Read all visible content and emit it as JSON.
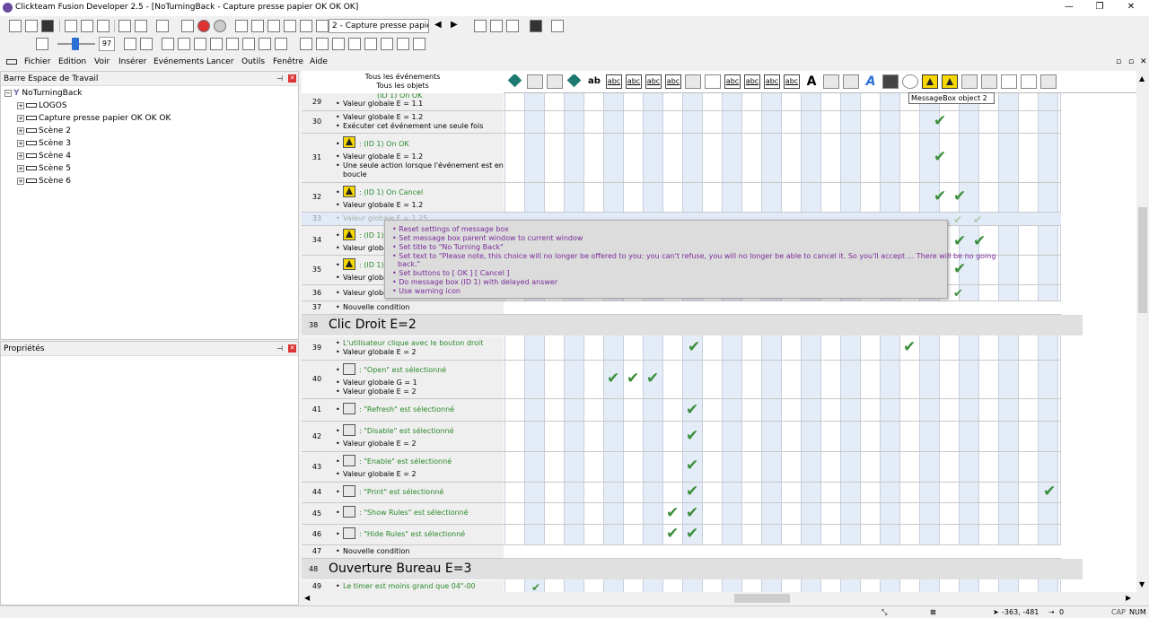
{
  "window": {
    "title": "Clickteam Fusion Developer 2.5 - [NoTurningBack - Capture presse papier OK OK OK]",
    "minimize": "—",
    "restore": "❐",
    "close": "✕"
  },
  "toolbar": {
    "frame_select": "2 - Capture presse papie",
    "zoom": "97"
  },
  "menu": [
    "Fichier",
    "Edition",
    "Voir",
    "Insérer",
    "Evénements",
    "Lancer",
    "Outils",
    "Fenêtre",
    "Aide"
  ],
  "workspace": {
    "title": "Barre Espace de Travail",
    "root": "NoTurningBack",
    "items": [
      "LOGOS",
      "Capture presse papier OK OK OK",
      "Scène 2",
      "Scène 3",
      "Scène 4",
      "Scène 5",
      "Scène 6"
    ]
  },
  "properties": {
    "title": "Propriétés"
  },
  "editor": {
    "header_line1": "Tous les événements",
    "header_line2": "Tous les objets",
    "tooltip": "MessageBox object 2",
    "rows": {
      "r29": {
        "num": "29",
        "l1": "(ID 1) On OK",
        "l2": "Valeur globale E = 1.1"
      },
      "r30": {
        "num": "30",
        "l1": "Valeur globale E = 1.2",
        "l2": "Exécuter cet événement une seule fois"
      },
      "r31": {
        "num": "31",
        "l1": ": (ID 1) On OK",
        "l2": "Valeur globale E = 1.2",
        "l3": "Une seule action lorsque l'événement est en",
        "l4": "boucle"
      },
      "r32": {
        "num": "32",
        "l1": ": (ID 1) On Cancel",
        "l2": "Valeur globale E = 1.2"
      },
      "r33": {
        "num": "33",
        "l1": "Valeur globale E = 1.25"
      },
      "r34": {
        "num": "34",
        "l1": ": (ID 1)",
        "l2": "Valeur globale"
      },
      "r35": {
        "num": "35",
        "l1": ": (ID 1)",
        "l2": "Valeur globale"
      },
      "r36": {
        "num": "36",
        "l1": "Valeur globale"
      },
      "r37": {
        "num": "37",
        "l1": "Nouvelle condition"
      },
      "g38": {
        "num": "38",
        "title": "Clic Droit E=2"
      },
      "r39": {
        "num": "39",
        "l1": "L'utilisateur clique avec le bouton droit",
        "l2": "Valeur globale E = 2"
      },
      "r40": {
        "num": "40",
        "l1": ": \"Open\" est sélectionné",
        "l2": "Valeur globale G = 1",
        "l3": "Valeur globale E = 2"
      },
      "r41": {
        "num": "41",
        "l1": ": \"Refresh\" est sélectionné"
      },
      "r42": {
        "num": "42",
        "l1": ": \"Disable\" est sélectionné",
        "l2": "Valeur globale E = 2"
      },
      "r43": {
        "num": "43",
        "l1": ": \"Enable\" est sélectionné",
        "l2": "Valeur globale E = 2"
      },
      "r44": {
        "num": "44",
        "l1": ": \"Print\" est sélectionné"
      },
      "r45": {
        "num": "45",
        "l1": ": \"Show Rules\" est sélectionné"
      },
      "r46": {
        "num": "46",
        "l1": ": \"Hide Rules\" est sélectionné"
      },
      "r47": {
        "num": "47",
        "l1": "Nouvelle condition"
      },
      "g48": {
        "num": "48",
        "title": "Ouverture Bureau E=3"
      },
      "r49": {
        "num": "49",
        "l1": "Le timer est moins grand que 04\"-00"
      }
    },
    "popup": [
      "Reset settings of message box",
      "Set message box parent window to current window",
      "Set title to \"No Turning Back\"",
      "Set text to \"Please note, this choice will no longer be offered to you: you can't refuse, you will no longer be able to cancel it. So you'll accept ... There will be no going",
      "back.\"",
      "Set buttons to [ OK ] [ Cancel ]",
      "Do message box (ID 1) with delayed answer",
      "Use warning icon"
    ]
  },
  "status": {
    "coords": "-363, -481",
    "count": "0",
    "cap": "CAP",
    "num": "NUM"
  }
}
